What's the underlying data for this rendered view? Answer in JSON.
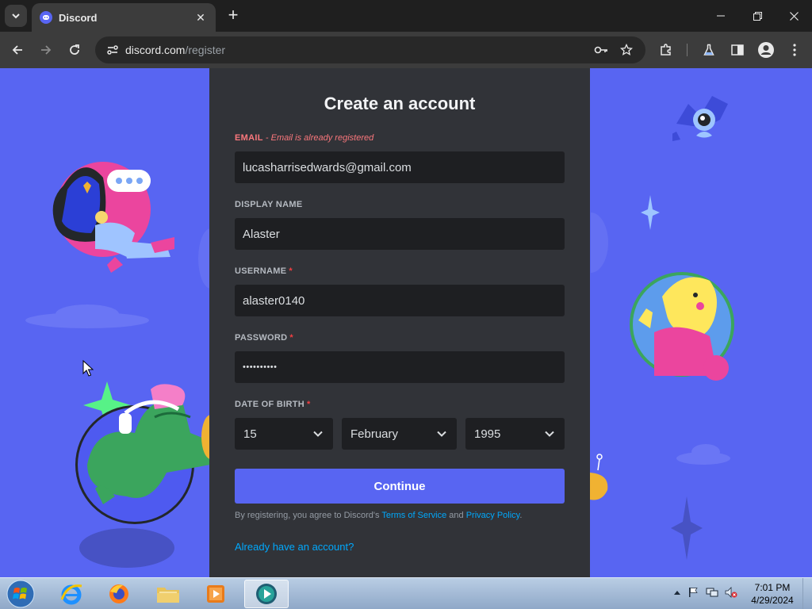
{
  "browser": {
    "tab_title": "Discord",
    "url_domain": "discord.com",
    "url_path": "/register"
  },
  "form": {
    "title": "Create an account",
    "email": {
      "label": "EMAIL",
      "error": "- Email is already registered",
      "value": "lucasharrisedwards@gmail.com"
    },
    "display_name": {
      "label": "DISPLAY NAME",
      "value": "Alaster"
    },
    "username": {
      "label": "USERNAME",
      "required": "*",
      "value": "alaster0140"
    },
    "password": {
      "label": "PASSWORD",
      "required": "*",
      "value": "••••••••••"
    },
    "dob": {
      "label": "DATE OF BIRTH",
      "required": "*",
      "day": "15",
      "month": "February",
      "year": "1995"
    },
    "continue_label": "Continue",
    "legal_prefix": "By registering, you agree to Discord's ",
    "terms_label": "Terms of Service",
    "legal_and": " and ",
    "privacy_label": "Privacy Policy",
    "legal_suffix": ".",
    "login_link": "Already have an account?"
  },
  "taskbar": {
    "time": "7:01 PM",
    "date": "4/29/2024"
  },
  "colors": {
    "discord_blurple": "#5865f2",
    "modal_bg": "#313338",
    "input_bg": "#1e1f22",
    "error": "#fa777c",
    "link": "#00a8fc"
  }
}
